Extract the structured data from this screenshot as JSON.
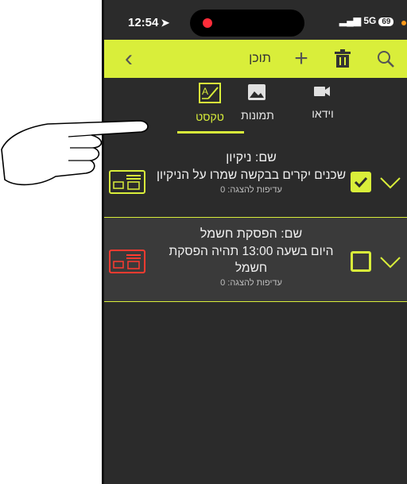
{
  "status": {
    "time": "12:54",
    "network": "5G",
    "battery": "69"
  },
  "toolbar": {
    "title": "תוכן"
  },
  "tabs": [
    {
      "label": "טקסט",
      "icon": "text-edit-icon",
      "active": true
    },
    {
      "label": "תמונות",
      "icon": "image-icon",
      "active": false
    },
    {
      "label": "וידאו",
      "icon": "video-icon",
      "active": false
    }
  ],
  "items": [
    {
      "name": "שם: ניקיון",
      "body": "שכנים יקרים בבקשה שמרו על הניקיון",
      "pref": "עדיפות להצגה: 0",
      "checked": true
    },
    {
      "name": "שם: הפסקת חשמל",
      "body": "היום בשעה 13:00 תהיה הפסקת חשמל",
      "pref": "עדיפות להצגה: 0",
      "checked": false
    }
  ],
  "colors": {
    "accent": "#d9ee3a",
    "background": "#2b2b2b",
    "alert": "#ff3b30"
  }
}
